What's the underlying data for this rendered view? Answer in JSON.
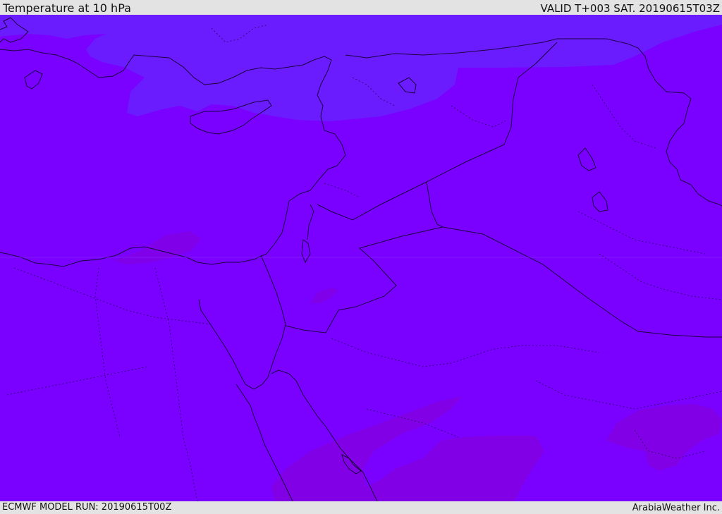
{
  "header": {
    "title": "Temperature at 10 hPa",
    "valid": "VALID T+003 SAT. 20190615T03Z"
  },
  "footer": {
    "model_run": "ECMWF MODEL RUN: 20190615T00Z",
    "credit": "ArabiaWeather Inc."
  },
  "colors": {
    "background_field": "#7a00ff",
    "cold_band": "#6b1cff",
    "warm_patch": "#8200dc",
    "borders": "#1a0040"
  }
}
